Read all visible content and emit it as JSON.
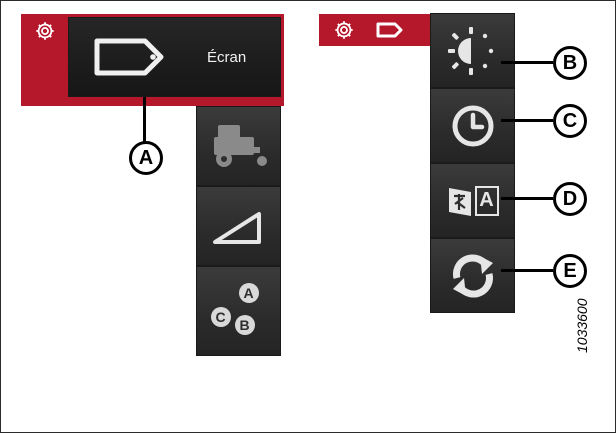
{
  "left_menu": {
    "settings_icon": "gear-icon",
    "display_tab": {
      "icon": "display-tag-icon",
      "label": "Écran"
    },
    "items": [
      {
        "icon": "combine-machine-icon"
      },
      {
        "icon": "header-angle-icon"
      },
      {
        "icon": "abc-options-icon",
        "letters": [
          "A",
          "C",
          "B"
        ]
      }
    ]
  },
  "right_menu": {
    "header_icons": [
      "gear-icon",
      "display-tag-icon"
    ],
    "items": [
      {
        "icon": "brightness-icon",
        "callout": "B"
      },
      {
        "icon": "clock-icon",
        "callout": "C"
      },
      {
        "icon": "language-icon",
        "callout": "D",
        "glyph": "A"
      },
      {
        "icon": "refresh-icon",
        "callout": "E"
      }
    ]
  },
  "callouts": {
    "display_tab": "A"
  },
  "figure_number": "1033600",
  "colors": {
    "accent_red": "#b5172b",
    "button_dark": "#2e2e2e",
    "icon_light": "#e6e6e6"
  }
}
